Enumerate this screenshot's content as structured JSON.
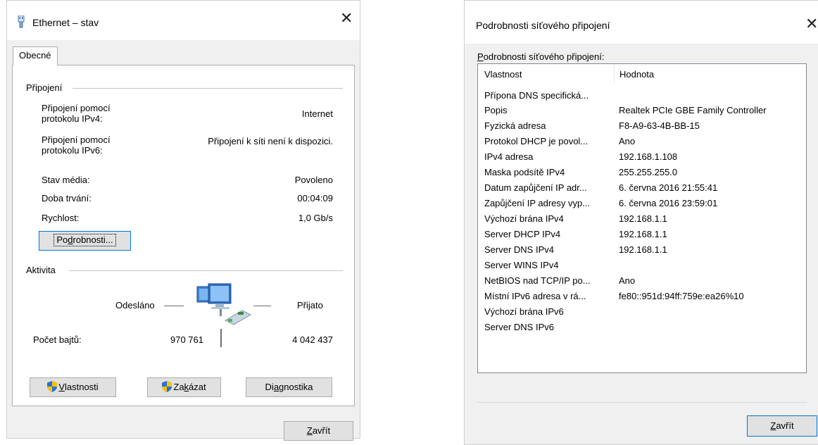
{
  "status_dialog": {
    "title": "Ethernet – stav",
    "close_glyph": "✕",
    "tab_label": "Obecné",
    "connection_group_label": "Připojení",
    "rows": {
      "ipv4_label_1": "Připojení pomocí",
      "ipv4_label_2": "protokolu IPv4:",
      "ipv4_value": "Internet",
      "ipv6_label_1": "Připojení pomocí",
      "ipv6_label_2": "protokolu IPv6:",
      "ipv6_value": "Připojení k síti není k dispozici.",
      "media_label": "Stav média:",
      "media_value": "Povoleno",
      "duration_label": "Doba trvání:",
      "duration_value": "00:04:09",
      "speed_label": "Rychlost:",
      "speed_value": "1,0 Gb/s"
    },
    "details_button_pre": "Po",
    "details_button_key": "d",
    "details_button_post": "robnosti...",
    "activity_group_label": "Aktivita",
    "sent_label": "Odesláno",
    "received_label": "Přijato",
    "bytes_label": "Počet bajtů:",
    "bytes_sent": "970 761",
    "bytes_received": "4 042 437",
    "properties_button_key": "V",
    "properties_button_rest": "lastnosti",
    "disable_button_pre": "Za",
    "disable_button_key": "k",
    "disable_button_post": "ázat",
    "diagnose_button_pre": "Di",
    "diagnose_button_key": "a",
    "diagnose_button_post": "gnostika",
    "close_button_key": "Z",
    "close_button_rest": "avřít"
  },
  "details_dialog": {
    "title": "Podrobnosti síťového připojení",
    "close_glyph": "✕",
    "list_label_key": "P",
    "list_label_rest": "odrobnosti síťového připojení:",
    "col_property": "Vlastnost",
    "col_value": "Hodnota",
    "rows": [
      {
        "property": "Přípona DNS specifická...",
        "value": ""
      },
      {
        "property": "Popis",
        "value": "Realtek PCIe GBE Family Controller"
      },
      {
        "property": "Fyzická adresa",
        "value": "F8-A9-63-4B-BB-15"
      },
      {
        "property": "Protokol DHCP je povol...",
        "value": "Ano"
      },
      {
        "property": "IPv4 adresa",
        "value": "192.168.1.108"
      },
      {
        "property": "Maska podsítě IPv4",
        "value": "255.255.255.0"
      },
      {
        "property": "Datum zapůjčení IP adr...",
        "value": "6. června 2016 21:55:41"
      },
      {
        "property": "Zapůjčení IP adresy vyp...",
        "value": "6. června 2016 23:59:01"
      },
      {
        "property": "Výchozí brána IPv4",
        "value": "192.168.1.1"
      },
      {
        "property": "Server DHCP IPv4",
        "value": "192.168.1.1"
      },
      {
        "property": "Server DNS IPv4",
        "value": "192.168.1.1"
      },
      {
        "property": "Server WINS IPv4",
        "value": ""
      },
      {
        "property": "NetBIOS nad TCP/IP po...",
        "value": "Ano"
      },
      {
        "property": "Místní IPv6 adresa v rá...",
        "value": "fe80::951d:94ff:759e:ea26%10"
      },
      {
        "property": "Výchozí brána IPv6",
        "value": ""
      },
      {
        "property": "Server DNS IPv6",
        "value": ""
      }
    ],
    "close_button_key": "Z",
    "close_button_rest": "avřít"
  },
  "colors": {
    "dialog_bg": "#f0f0f0",
    "focus_accent": "#0078d7",
    "shield_blue": "#2a6fd6",
    "shield_yellow": "#f5c400"
  },
  "icons": [
    "network-adapter-icon",
    "network-computers-icon",
    "uac-shield-icon",
    "close-icon"
  ]
}
